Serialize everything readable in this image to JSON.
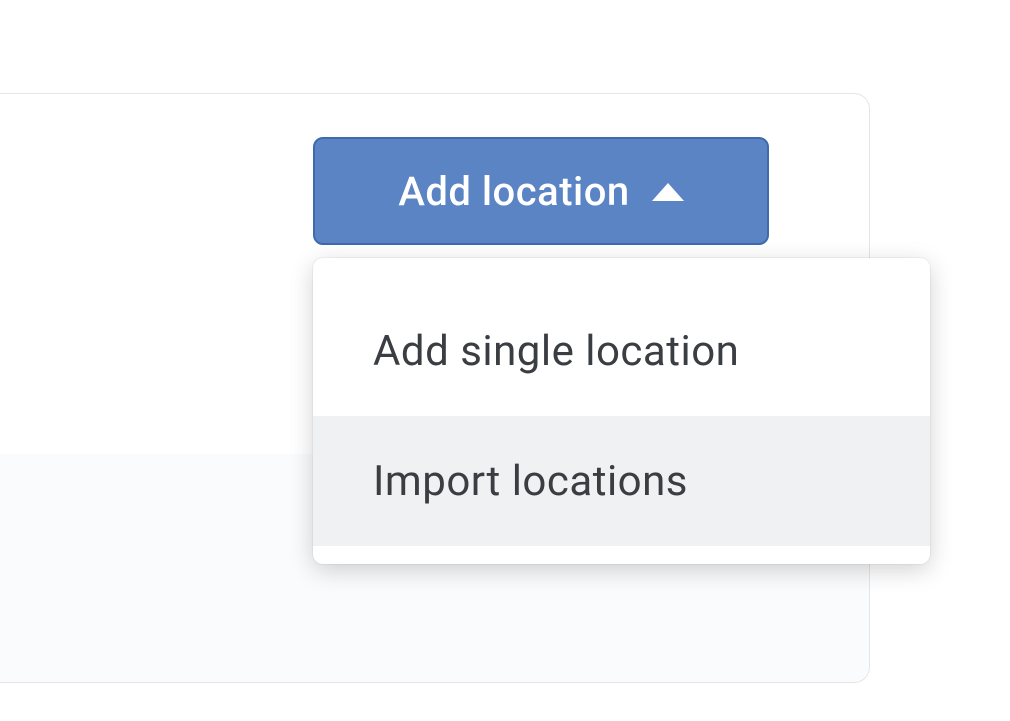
{
  "button": {
    "label": "Add location"
  },
  "menu": {
    "items": [
      {
        "label": "Add single location",
        "hover": false
      },
      {
        "label": "Import locations",
        "hover": true
      }
    ]
  },
  "colors": {
    "button_bg": "#5b84c4",
    "button_border": "#3f6aad",
    "hover_bg": "#f0f1f2",
    "panel_border": "#e3e5e8",
    "panel_fill": "#fafbfc"
  }
}
